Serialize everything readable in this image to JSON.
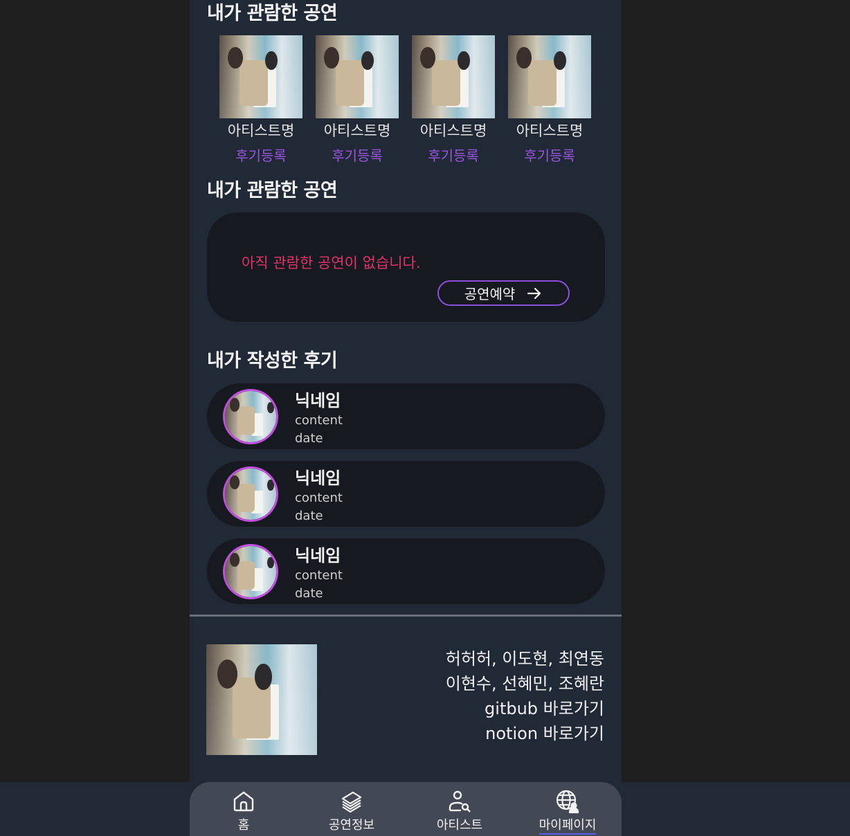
{
  "watched_section": {
    "title": "내가 관람한 공연",
    "items": [
      {
        "artist": "아티스트명",
        "action": "후기등록"
      },
      {
        "artist": "아티스트명",
        "action": "후기등록"
      },
      {
        "artist": "아티스트명",
        "action": "후기등록"
      },
      {
        "artist": "아티스트명",
        "action": "후기등록"
      }
    ]
  },
  "watched_empty_section": {
    "title": "내가 관람한 공연",
    "empty_message": "아직 관람한 공연이 없습니다.",
    "reserve_label": "공연예약"
  },
  "reviews_section": {
    "title": "내가 작성한 후기",
    "items": [
      {
        "nickname": "닉네임",
        "content": "content",
        "date": "date"
      },
      {
        "nickname": "닉네임",
        "content": "content",
        "date": "date"
      },
      {
        "nickname": "닉네임",
        "content": "content",
        "date": "date"
      }
    ]
  },
  "footer": {
    "lines": [
      "허허허, 이도현, 최연동",
      "이현수, 선혜민, 조혜란",
      "gitbub 바로가기",
      "notion 바로가기"
    ]
  },
  "nav": {
    "items": [
      {
        "label": "홈",
        "icon": "home-icon"
      },
      {
        "label": "공연정보",
        "icon": "stack-icon"
      },
      {
        "label": "아티스트",
        "icon": "user-search-icon"
      },
      {
        "label": "마이페이지",
        "icon": "globe-user-icon",
        "active": true
      }
    ]
  },
  "colors": {
    "background": "#212936",
    "card": "#16191f",
    "accent_purple": "#9a55e0",
    "empty_text": "#e2326a",
    "nav": "#434954"
  }
}
